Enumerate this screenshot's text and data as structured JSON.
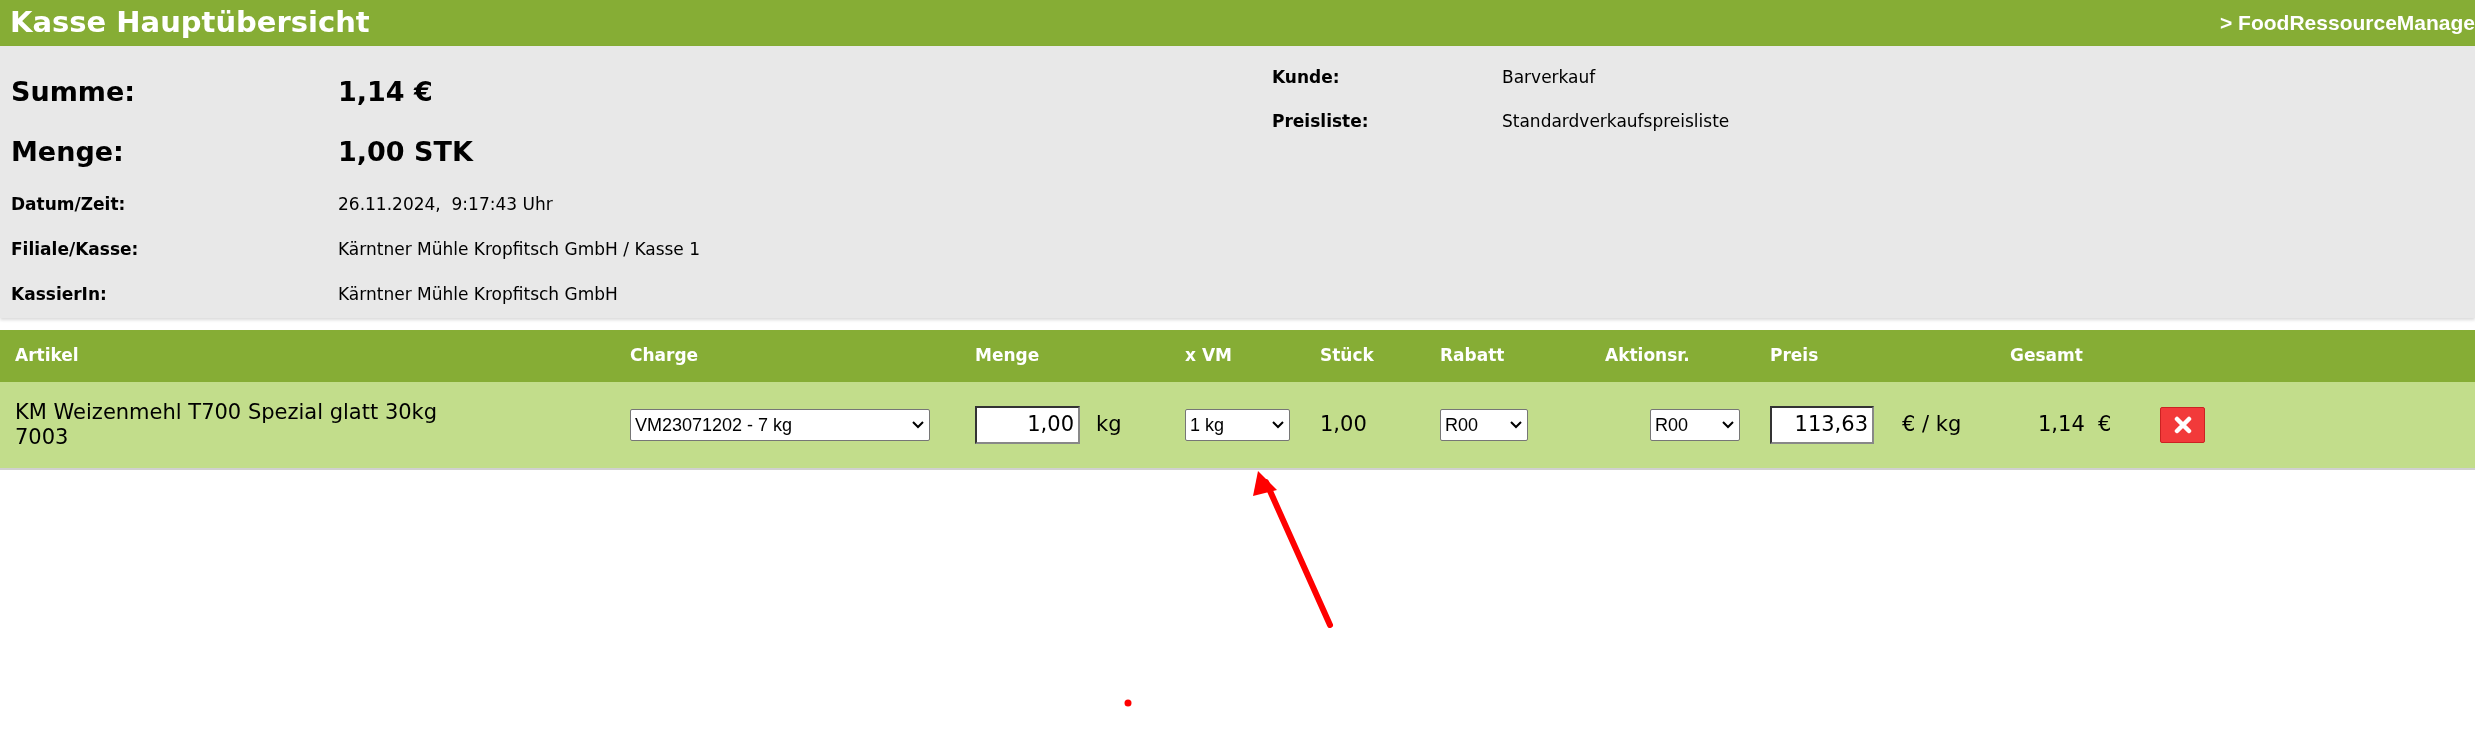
{
  "header": {
    "title": "Kasse Hauptübersicht",
    "brand": "> FoodRessourceManage"
  },
  "summary": [
    {
      "kind": "big",
      "label": "Summe:",
      "value": "1,14 €"
    },
    {
      "kind": "big",
      "label": "Menge:",
      "value": "1,00 STK"
    },
    {
      "kind": "small",
      "label": "Datum/Zeit:",
      "value": "26.11.2024,  9:17:43 Uhr"
    },
    {
      "kind": "small",
      "label": "Filiale/Kasse:",
      "value": "Kärntner Mühle Kropfitsch GmbH / Kasse 1"
    },
    {
      "kind": "small",
      "label": "KassierIn:",
      "value": "Kärntner Mühle Kropfitsch GmbH"
    }
  ],
  "customer_info": [
    {
      "label": "Kunde:",
      "value": "Barverkauf"
    },
    {
      "label": "Preisliste:",
      "value": "Standardverkaufspreisliste"
    }
  ],
  "table": {
    "columns": [
      "Artikel",
      "Charge",
      "Menge",
      "x VM",
      "Stück",
      "Rabatt",
      "Aktionsr.",
      "Preis",
      "Gesamt"
    ],
    "rows": [
      {
        "article": "KM Weizenmehl T700 Spezial glatt 30kg",
        "article_number": "7003",
        "charge": "VM23071202 - 7 kg",
        "menge": "1,00",
        "menge_unit": "kg",
        "vm": "1 kg",
        "stueck": "1,00",
        "rabatt": "R00",
        "aktion": "R00",
        "preis": "113,63",
        "preis_unit": "€ / kg",
        "gesamt": "1,14  €"
      }
    ]
  }
}
